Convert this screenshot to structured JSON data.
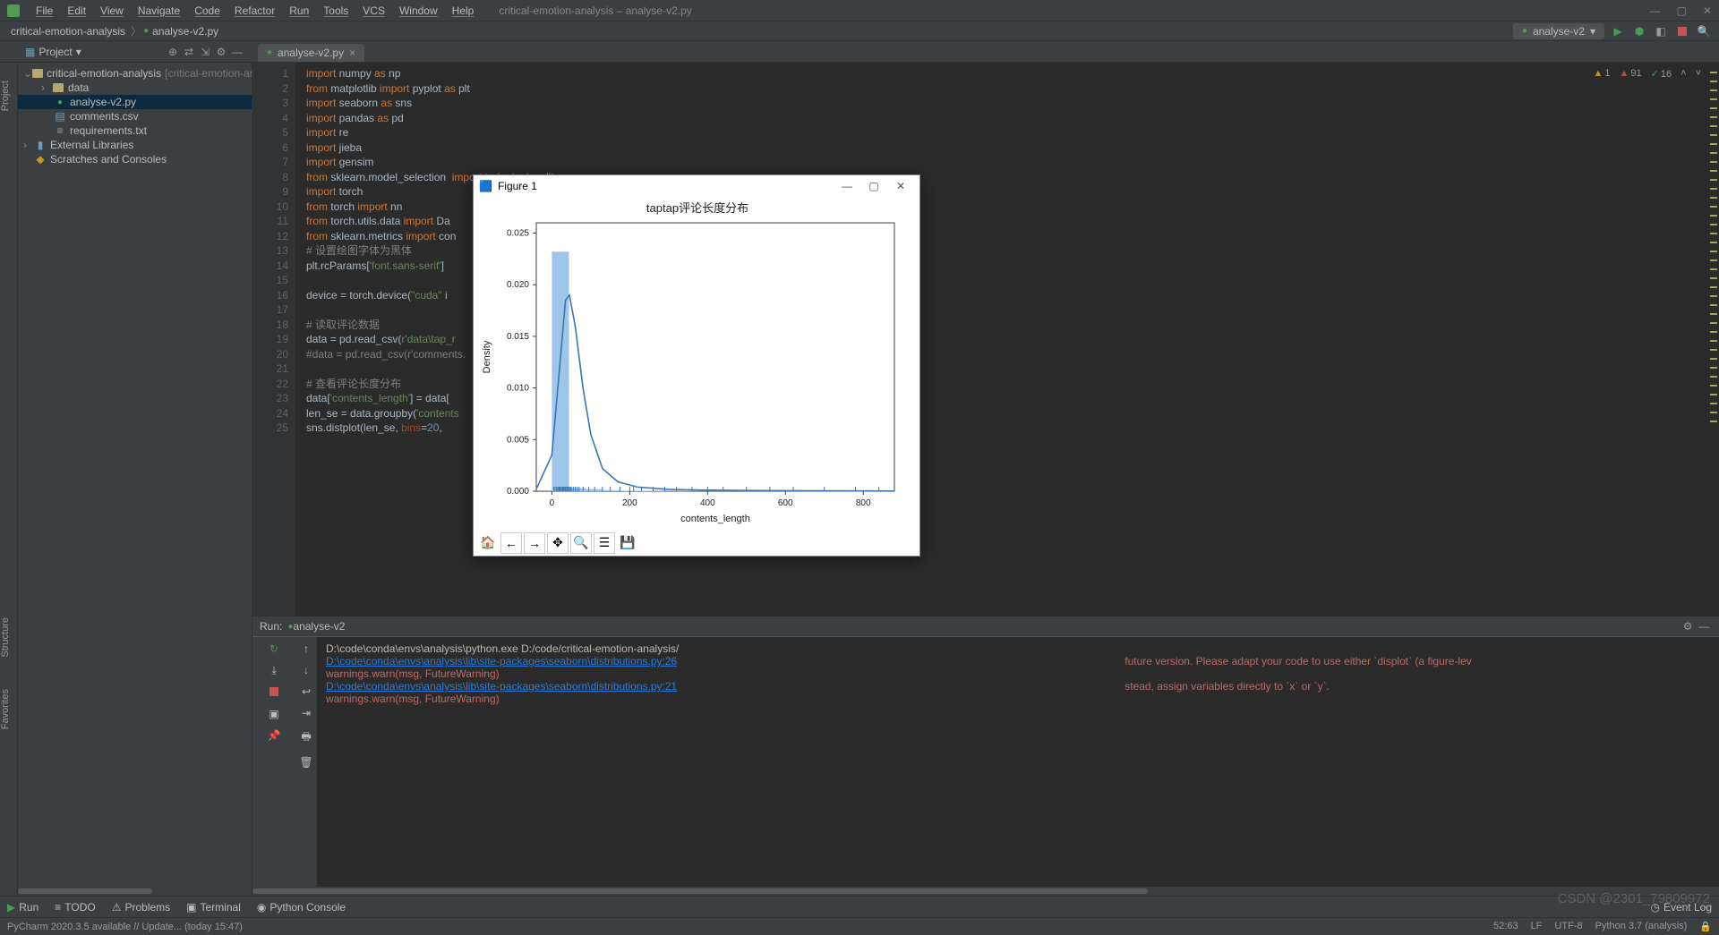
{
  "menu": [
    "File",
    "Edit",
    "View",
    "Navigate",
    "Code",
    "Refactor",
    "Run",
    "Tools",
    "VCS",
    "Window",
    "Help"
  ],
  "window_title": "critical-emotion-analysis – analyse-v2.py",
  "breadcrumb": {
    "root": "critical-emotion-analysis",
    "file": "analyse-v2.py"
  },
  "run_config": {
    "name": "analyse-v2"
  },
  "project": {
    "label": "Project",
    "root": "critical-emotion-analysis",
    "root_hint": "[critical-emotion-analysis",
    "items": [
      "data",
      "analyse-v2.py",
      "comments.csv",
      "requirements.txt"
    ],
    "external": "External Libraries",
    "scratches": "Scratches and Consoles"
  },
  "editor_tab": "analyse-v2.py",
  "inspections": {
    "warn": "1",
    "err": "91",
    "chk": "16"
  },
  "code_lines": [
    {
      "n": 1,
      "h": "<span class='k-import'>import</span> numpy <span class='k-as'>as</span> np"
    },
    {
      "n": 2,
      "h": "<span class='k-import'>from</span> matplotlib <span class='k-import'>import</span> pyplot <span class='k-as'>as</span> plt"
    },
    {
      "n": 3,
      "h": "<span class='k-import'>import</span> seaborn <span class='k-as'>as</span> sns"
    },
    {
      "n": 4,
      "h": "<span class='k-import'>import</span> pandas <span class='k-as'>as</span> pd"
    },
    {
      "n": 5,
      "h": "<span class='k-import'>import</span> re"
    },
    {
      "n": 6,
      "h": "<span class='k-import'>import</span> jieba"
    },
    {
      "n": 7,
      "h": "<span class='k-import'>import</span> gensim"
    },
    {
      "n": 8,
      "h": "<span class='k-import'>from</span> sklearn.model_selection  <span class='k-import'>import</span> train_test_split"
    },
    {
      "n": 9,
      "h": "<span class='k-import'>import</span> torch"
    },
    {
      "n": 10,
      "h": "<span class='k-import'>from</span> torch <span class='k-import'>import</span> nn"
    },
    {
      "n": 11,
      "h": "<span class='k-import'>from</span> torch.utils.data <span class='k-import'>import</span> Da"
    },
    {
      "n": 12,
      "h": "<span class='k-import'>from</span> sklearn.metrics <span class='k-import'>import</span> con"
    },
    {
      "n": 13,
      "h": "<span class='k-comment'># 设置绘图字体为黑体</span>"
    },
    {
      "n": 14,
      "h": "plt.rcParams[<span class='k-str'>'font.sans-serif'</span>]"
    },
    {
      "n": 15,
      "h": ""
    },
    {
      "n": 16,
      "h": "device = torch.device(<span class='k-str'>\"cuda\"</span> i"
    },
    {
      "n": 17,
      "h": ""
    },
    {
      "n": 18,
      "h": "<span class='k-comment'># 读取评论数据</span>"
    },
    {
      "n": 19,
      "h": "data = pd.read_csv(<span class='k-str'>r'data\\tap_r</span>"
    },
    {
      "n": 20,
      "h": "<span class='k-comment'>#data = pd.read_csv(r'comments.</span>"
    },
    {
      "n": 21,
      "h": ""
    },
    {
      "n": 22,
      "h": "<span class='k-comment'># 查看评论长度分布</span>"
    },
    {
      "n": 23,
      "h": "data[<span class='k-str'>'contents_length'</span>] = data["
    },
    {
      "n": 24,
      "h": "len_se = data.groupby(<span class='k-str'>'contents</span>"
    },
    {
      "n": 25,
      "h": "sns.distplot(len_se, <span class='k-param'>bins</span>=<span class='k-num'>20</span>, "
    }
  ],
  "run": {
    "label": "Run:",
    "config": "analyse-v2",
    "lines": [
      {
        "t": "plain",
        "v": "D:\\code\\conda\\envs\\analysis\\python.exe D:/code/critical-emotion-analysis/"
      },
      {
        "t": "link",
        "v": "D:\\code\\conda\\envs\\analysis\\lib\\site-packages\\seaborn\\distributions.py:26",
        "tail": "future version. Please adapt your code to use either `displot` (a figure-lev"
      },
      {
        "t": "warn",
        "v": "  warnings.warn(msg, FutureWarning)"
      },
      {
        "t": "link",
        "v": "D:\\code\\conda\\envs\\analysis\\lib\\site-packages\\seaborn\\distributions.py:21",
        "tail": "stead, assign variables directly to `x` or `y`."
      },
      {
        "t": "warn",
        "v": "  warnings.warn(msg, FutureWarning)"
      }
    ]
  },
  "bottom_tools": {
    "run": "Run",
    "todo": "TODO",
    "problems": "Problems",
    "terminal": "Terminal",
    "python_console": "Python Console",
    "event_log": "Event Log"
  },
  "status": {
    "left": "PyCharm 2020.3.5 available // Update... (today 15:47)",
    "pos": "52:63",
    "enc": "LF",
    "charset": "UTF-8",
    "interp": "Python 3.7 (analysis)"
  },
  "left_tabs": {
    "project": "Project",
    "structure": "Structure",
    "favorites": "Favorites"
  },
  "figure": {
    "title": "Figure 1",
    "chart_title": "taptap评论长度分布",
    "xlabel": "contents_length",
    "ylabel": "Density"
  },
  "chart_data": {
    "type": "bar",
    "title": "taptap评论长度分布",
    "xlabel": "contents_length",
    "ylabel": "Density",
    "x_ticks": [
      0,
      200,
      400,
      600,
      800
    ],
    "y_ticks": [
      0.0,
      0.005,
      0.01,
      0.015,
      0.02,
      0.025
    ],
    "xlim": [
      -40,
      880
    ],
    "ylim": [
      0,
      0.026
    ],
    "bin_width": 44,
    "bins": [
      {
        "x0": 0,
        "x1": 44,
        "density": 0.0232
      },
      {
        "x0": 44,
        "x1": 88,
        "density": 0.0003
      },
      {
        "x0": 88,
        "x1": 132,
        "density": 0.0002
      },
      {
        "x0": 132,
        "x1": 176,
        "density": 0.0001
      },
      {
        "x0": 176,
        "x1": 220,
        "density": 5e-05
      },
      {
        "x0": 220,
        "x1": 264,
        "density": 5e-05
      },
      {
        "x0": 264,
        "x1": 308,
        "density": 3e-05
      },
      {
        "x0": 308,
        "x1": 352,
        "density": 3e-05
      },
      {
        "x0": 352,
        "x1": 396,
        "density": 2e-05
      },
      {
        "x0": 396,
        "x1": 440,
        "density": 2e-05
      },
      {
        "x0": 440,
        "x1": 484,
        "density": 1e-05
      },
      {
        "x0": 484,
        "x1": 528,
        "density": 1e-05
      },
      {
        "x0": 528,
        "x1": 572,
        "density": 1e-05
      },
      {
        "x0": 572,
        "x1": 616,
        "density": 1e-05
      },
      {
        "x0": 616,
        "x1": 660,
        "density": 1e-05
      },
      {
        "x0": 660,
        "x1": 704,
        "density": 1e-05
      },
      {
        "x0": 704,
        "x1": 748,
        "density": 1e-05
      },
      {
        "x0": 748,
        "x1": 792,
        "density": 1e-05
      },
      {
        "x0": 792,
        "x1": 836,
        "density": 1e-05
      },
      {
        "x0": 836,
        "x1": 880,
        "density": 1e-05
      }
    ],
    "kde": [
      {
        "x": -40,
        "y": 0.0002
      },
      {
        "x": 0,
        "y": 0.0035
      },
      {
        "x": 20,
        "y": 0.012
      },
      {
        "x": 35,
        "y": 0.0185
      },
      {
        "x": 45,
        "y": 0.019
      },
      {
        "x": 60,
        "y": 0.016
      },
      {
        "x": 80,
        "y": 0.01
      },
      {
        "x": 100,
        "y": 0.0055
      },
      {
        "x": 130,
        "y": 0.0022
      },
      {
        "x": 170,
        "y": 0.0009
      },
      {
        "x": 220,
        "y": 0.0004
      },
      {
        "x": 300,
        "y": 0.00018
      },
      {
        "x": 400,
        "y": 0.0001
      },
      {
        "x": 500,
        "y": 7e-05
      },
      {
        "x": 600,
        "y": 5e-05
      },
      {
        "x": 700,
        "y": 4e-05
      },
      {
        "x": 800,
        "y": 3e-05
      },
      {
        "x": 880,
        "y": 2e-05
      }
    ],
    "rug": [
      5,
      8,
      12,
      15,
      18,
      20,
      22,
      25,
      28,
      30,
      33,
      35,
      38,
      40,
      42,
      45,
      48,
      50,
      55,
      60,
      65,
      70,
      80,
      95,
      110,
      130,
      150,
      175,
      200,
      210,
      230,
      260,
      290,
      320,
      360,
      400,
      440,
      500,
      560,
      620,
      700,
      780,
      840
    ]
  },
  "watermark": "CSDN @2301_79809972"
}
